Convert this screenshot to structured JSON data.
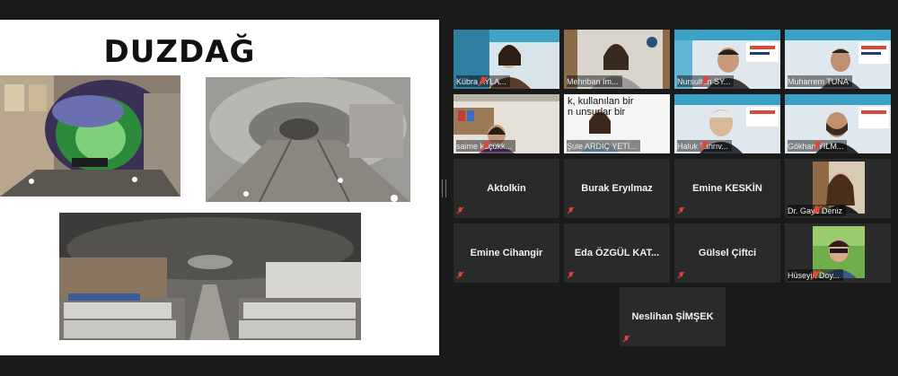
{
  "slide": {
    "title": "DUZDAĞ"
  },
  "participants": [
    {
      "name": "Kübra AYLA...",
      "muted": true
    },
    {
      "name": "Mehriban Im...",
      "muted": false
    },
    {
      "name": "Nursultan SY...",
      "muted": true
    },
    {
      "name": "Muharrem TUNA",
      "muted": false
    },
    {
      "name": "saime küçükk...",
      "muted": true
    },
    {
      "name": "Şule ARDIÇ YETİ...",
      "muted": false,
      "active_speaker": true,
      "overlay_lines": [
        "k, kullanılan bir",
        "n unsurlar bir"
      ]
    },
    {
      "name": "Haluk Tanrıv...",
      "muted": true
    },
    {
      "name": "Gökhan YILM...",
      "muted": true
    },
    {
      "name": "Aktolkin",
      "muted": true
    },
    {
      "name": "Burak Eryılmaz",
      "muted": true
    },
    {
      "name": "Emine KESKİN",
      "muted": true
    },
    {
      "name": "Dr. Gaye Deniz",
      "muted": true
    },
    {
      "name": "Emine Cihangir",
      "muted": true
    },
    {
      "name": "Eda ÖZGÜL KAT...",
      "muted": true
    },
    {
      "name": "Gülsel Çiftci",
      "muted": true
    },
    {
      "name": "Hüseyin Doy...",
      "muted": true
    },
    {
      "name": "Neslihan ŞİMŞEK",
      "muted": true
    }
  ],
  "colors": {
    "background": "#1a1a1a",
    "tile": "#2b2b2b",
    "active_border": "#c8d64a",
    "muted_icon": "#e0473a"
  }
}
